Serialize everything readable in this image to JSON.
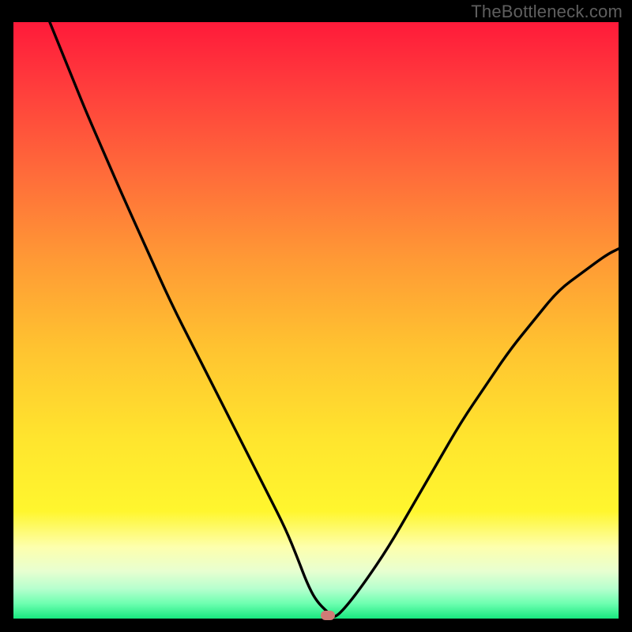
{
  "watermark": {
    "text": "TheBottleneck.com"
  },
  "colors": {
    "frame": "#000000",
    "gradient_stops": [
      {
        "offset": 0.0,
        "color": "#ff1a3a"
      },
      {
        "offset": 0.1,
        "color": "#ff3a3c"
      },
      {
        "offset": 0.25,
        "color": "#ff6a3a"
      },
      {
        "offset": 0.4,
        "color": "#ff9a35"
      },
      {
        "offset": 0.55,
        "color": "#ffc430"
      },
      {
        "offset": 0.7,
        "color": "#ffe52e"
      },
      {
        "offset": 0.82,
        "color": "#fff62e"
      },
      {
        "offset": 0.88,
        "color": "#fdffad"
      },
      {
        "offset": 0.92,
        "color": "#e8ffd0"
      },
      {
        "offset": 0.95,
        "color": "#b6ffce"
      },
      {
        "offset": 0.975,
        "color": "#6dffb0"
      },
      {
        "offset": 1.0,
        "color": "#18e87f"
      }
    ],
    "curve": "#000000",
    "marker": "#cf7b76"
  },
  "chart_data": {
    "type": "line",
    "title": "",
    "xlabel": "",
    "ylabel": "",
    "xlim": [
      0,
      100
    ],
    "ylim": [
      0,
      100
    ],
    "grid": false,
    "legend": false,
    "series": [
      {
        "name": "bottleneck-curve",
        "x": [
          6,
          8,
          10,
          12,
          15,
          18,
          22,
          26,
          30,
          34,
          38,
          42,
          45,
          47,
          48.5,
          50,
          52,
          53,
          55,
          58,
          62,
          66,
          70,
          74,
          78,
          82,
          86,
          90,
          94,
          98,
          100
        ],
        "values": [
          100,
          95,
          90,
          85,
          78,
          71,
          62,
          53,
          45,
          37,
          29,
          21,
          15,
          10,
          6,
          3,
          1,
          0,
          2,
          6,
          12,
          19,
          26,
          33,
          39,
          45,
          50,
          55,
          58,
          61,
          62
        ]
      }
    ],
    "annotations": [
      {
        "name": "optimum-marker",
        "x": 52,
        "y": 0.5
      }
    ]
  }
}
